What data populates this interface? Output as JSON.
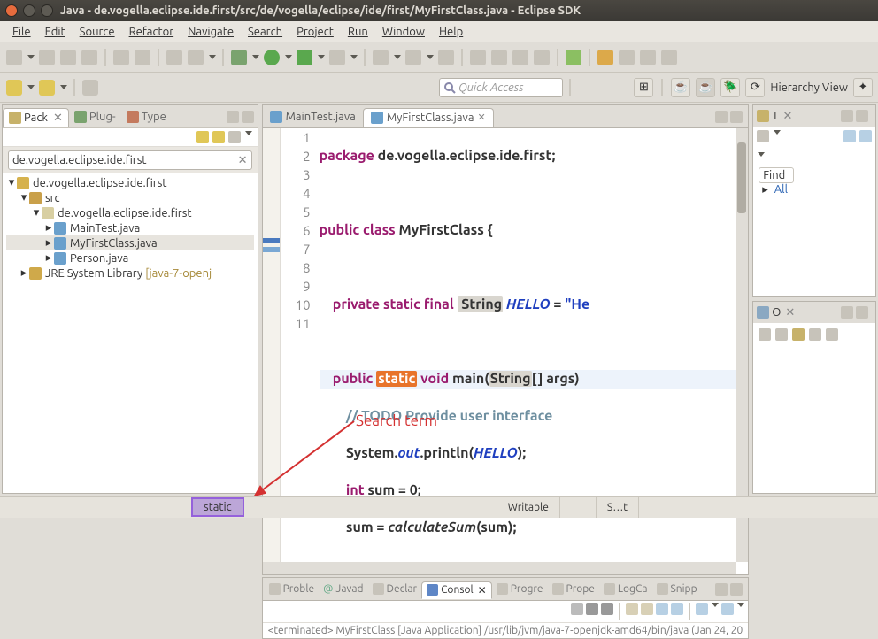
{
  "title": "Java - de.vogella.eclipse.ide.first/src/de/vogella/eclipse/ide/first/MyFirstClass.java - Eclipse SDK",
  "menu": [
    "File",
    "Edit",
    "Source",
    "Refactor",
    "Navigate",
    "Search",
    "Project",
    "Run",
    "Window",
    "Help"
  ],
  "quick_access_placeholder": "Quick Access",
  "perspective_label": "Hierarchy View",
  "left": {
    "tabs": {
      "pack": "Pack",
      "plug": "Plug-",
      "type": "Type"
    },
    "filter": "de.vogella.eclipse.ide.first",
    "tree": {
      "proj": "de.vogella.eclipse.ide.first",
      "src": "src",
      "pkg": "de.vogella.eclipse.ide.first",
      "files": [
        "MainTest.java",
        "MyFirstClass.java",
        "Person.java"
      ],
      "lib": "JRE System Library",
      "lib_tag": "[java-7-openj"
    }
  },
  "editor": {
    "tabs": {
      "main": "MainTest.java",
      "first": "MyFirstClass.java"
    },
    "code": {
      "l1a": "package",
      "l1b": " de.vogella.eclipse.ide.first;",
      "l3a": "public",
      "l3b": " class",
      "l3c": " MyFirstClass {",
      "l5a": "private",
      "l5b": " static",
      "l5c": " final",
      "l5d": " String",
      "l5e": " HELLO",
      "l5f": " = ",
      "l5g": "\"He",
      "l7a": "public",
      "l7b": "static",
      "l7c": " void",
      "l7d": " main(",
      "l7e": "String",
      "l7f": "[] args)",
      "l8a": "// ",
      "l8b": "TODO",
      "l8c": " Provide user interface",
      "l9a": "System.",
      "l9b": "out",
      "l9c": ".println(",
      "l9d": "HELLO",
      "l9e": ");",
      "l10a": "int",
      "l10b": " sum = 0;",
      "l11a": "sum = ",
      "l11b": "calculateSum",
      "l11c": "(sum);"
    },
    "lines": [
      "1",
      "2",
      "3",
      "4",
      "5",
      "6",
      "7",
      "8",
      "9",
      "10",
      "11"
    ]
  },
  "right": {
    "t1": "T",
    "find": "Find",
    "all": "All",
    "o1": "O"
  },
  "bottom": {
    "tabs": [
      "Proble",
      "Javad",
      "Declar",
      "Consol",
      "Progre",
      "Prope",
      "LogCa",
      "Snipp"
    ],
    "console_line": "<terminated> MyFirstClass [Java Application] /usr/lib/jvm/java-7-openjdk-amd64/bin/java (Jan 24, 20"
  },
  "annotation": {
    "label": "Search term"
  },
  "status": {
    "search_term": "static",
    "writable": "Writable",
    "insert": "S…t"
  }
}
